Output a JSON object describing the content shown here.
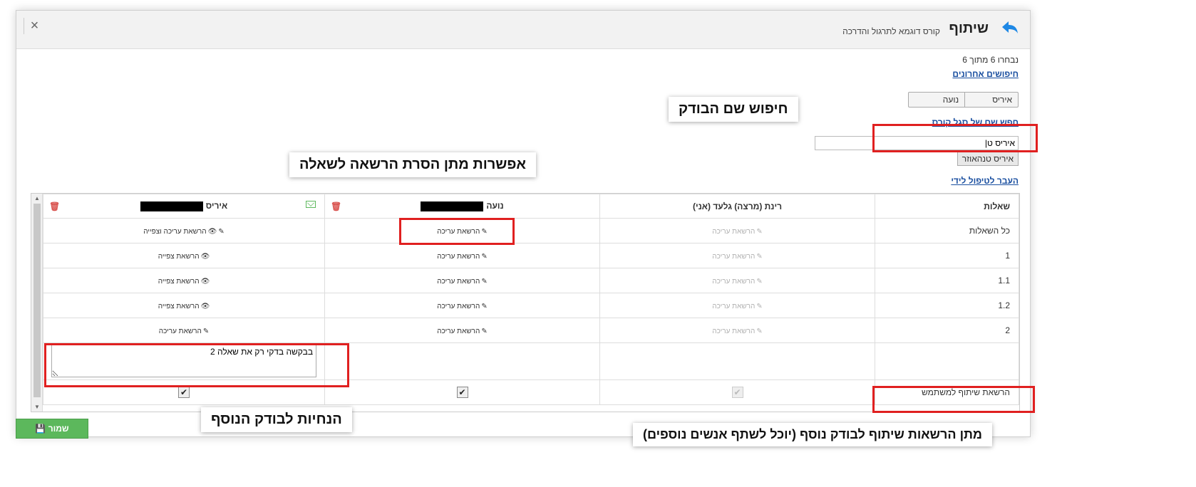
{
  "header": {
    "title": "שיתוף",
    "subtitle": "קורס דוגמא לתרגול והדרכה",
    "close": "×"
  },
  "selection": {
    "count_text": "נבחרו 6 מתוך 6",
    "recent_link": "חיפושים אחרונים",
    "chips": [
      "נועה",
      "איריס"
    ],
    "staff_link": "חפש שם של סגל קורס",
    "search_value": "איריס ט|",
    "suggestion": "איריס טנהאוזר",
    "transfer_link": "העבר לטיפול לידי"
  },
  "table": {
    "headers": {
      "questions": "שאלות",
      "rinat": "רינת (מרצה) גלעד (אני)",
      "noa": "נועה",
      "iris": "איריס"
    },
    "rows": [
      {
        "q": "כל השאלות",
        "rinat": "הרשאת עריכה",
        "noa": "הרשאת עריכה",
        "iris": "הרשאת עריכה וצפייה"
      },
      {
        "q": "1",
        "rinat": "הרשאת עריכה",
        "noa": "הרשאת עריכה",
        "iris": "הרשאת צפייה"
      },
      {
        "q": "1.1",
        "rinat": "הרשאת עריכה",
        "noa": "הרשאת עריכה",
        "iris": "הרשאת צפייה"
      },
      {
        "q": "1.2",
        "rinat": "הרשאת עריכה",
        "noa": "הרשאת עריכה",
        "iris": "הרשאת צפייה"
      },
      {
        "q": "2",
        "rinat": "הרשאת עריכה",
        "noa": "הרשאת עריכה",
        "iris": "הרשאת עריכה"
      }
    ],
    "note_text": "בבקשה בדקי רק את שאלה 2",
    "share_perm_label": "הרשאת שיתוף למשתמש"
  },
  "save_label": "שמור",
  "callouts": {
    "search_reviewer": "חיפוש שם הבודק",
    "remove_permission": "אפשרות מתן הסרת הרשאה לשאלה",
    "instructions": "הנחיות לבודק הנוסף",
    "share_permission": "מתן הרשאות שיתוף  לבודק נוסף (יוכל לשתף אנשים נוספים)"
  },
  "colors": {
    "save": "#5cb85c",
    "link": "#1a4fa0",
    "highlight": "#e02020"
  }
}
